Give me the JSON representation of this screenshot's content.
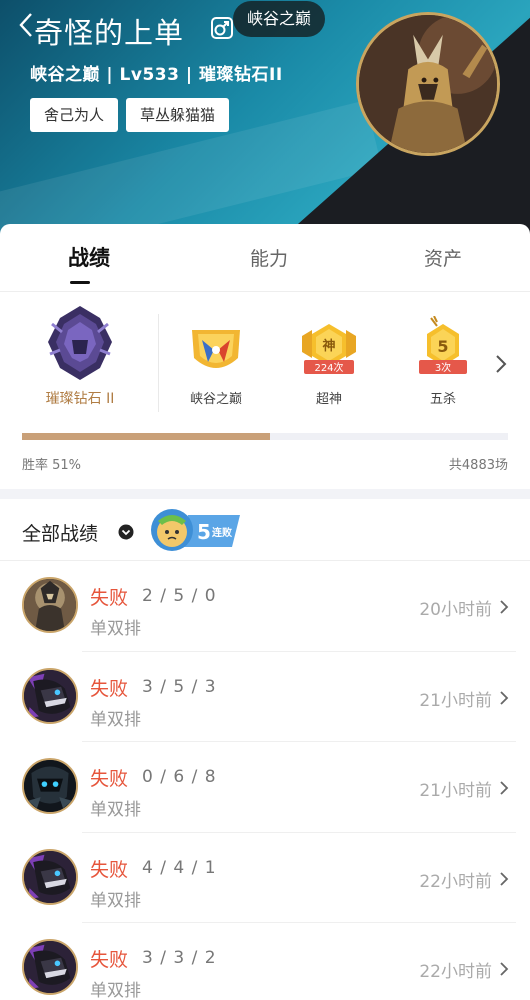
{
  "header": {
    "username": "奇怪的上单",
    "chip": "峡谷之巅",
    "subline": "峡谷之巅 | Lv533 | 璀璨钻石II",
    "tags": [
      "舍己为人",
      "草丛躲猫猫"
    ]
  },
  "tabs": [
    {
      "label": "战绩",
      "active": true
    },
    {
      "label": "能力",
      "active": false
    },
    {
      "label": "资产",
      "active": false
    }
  ],
  "badges": {
    "rank": {
      "label": "璀璨钻石 II",
      "icon": "diamond-rank-icon"
    },
    "summit": {
      "label": "峡谷之巅",
      "icon": "summit-shield-icon"
    },
    "godlike": {
      "label": "超神",
      "count": "224次",
      "glyph": "神"
    },
    "penta": {
      "label": "五杀",
      "count": "3次",
      "glyph": "5"
    }
  },
  "stats": {
    "winrate_label": "胜率 51%",
    "winrate": 0.51,
    "total_label": "共4883场"
  },
  "records": {
    "title": "全部战绩",
    "streak": {
      "number": "5",
      "text": "连败"
    },
    "items": [
      {
        "result": "失败",
        "kda": "2 / 5 / 0",
        "mode": "单双排",
        "time": "20小时前",
        "hero": "hero-knight-icon"
      },
      {
        "result": "失败",
        "kda": "3 / 5 / 3",
        "mode": "单双排",
        "time": "21小时前",
        "hero": "hero-jackal-icon"
      },
      {
        "result": "失败",
        "kda": "0 / 6 / 8",
        "mode": "单双排",
        "time": "21小时前",
        "hero": "hero-void-icon"
      },
      {
        "result": "失败",
        "kda": "4 / 4 / 1",
        "mode": "单双排",
        "time": "22小时前",
        "hero": "hero-jackal-icon"
      },
      {
        "result": "失败",
        "kda": "3 / 3 / 2",
        "mode": "单双排",
        "time": "22小时前",
        "hero": "hero-jackal-icon"
      }
    ]
  },
  "colors": {
    "header_teal": "#1a8aa7",
    "loss_red": "#e6553b",
    "rank_gold": "#b07d44",
    "bar_fill": "#c9a078"
  }
}
